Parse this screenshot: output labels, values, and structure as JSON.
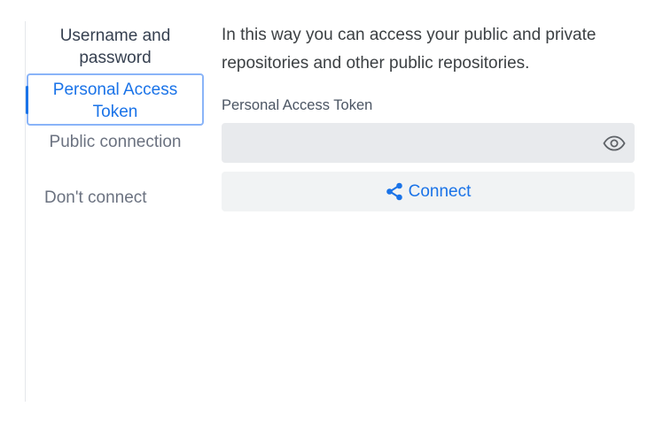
{
  "tabs": [
    {
      "label": "Username and password"
    },
    {
      "label": "Personal Access Token"
    },
    {
      "label": "Public connection"
    },
    {
      "label": "Don't connect"
    }
  ],
  "content": {
    "intro": "In this way you can access your public and private repositories and other public repositories.",
    "token_label": "Personal Access Token",
    "token_value": "",
    "connect_label": "Connect"
  },
  "colors": {
    "accent": "#1a73e8",
    "active_border": "#8ab4f8",
    "input_bg": "#e8eaed",
    "button_bg": "#f1f3f4",
    "muted_text": "#6b7280"
  },
  "icons": {
    "toggle_visibility": "eye-icon",
    "connect": "share-icon"
  }
}
